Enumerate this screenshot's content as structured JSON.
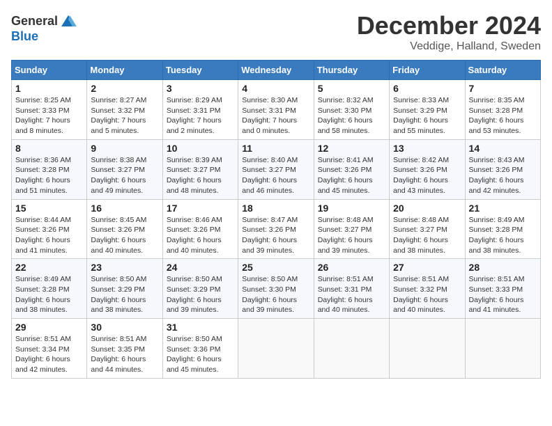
{
  "header": {
    "logo_line1": "General",
    "logo_line2": "Blue",
    "month": "December 2024",
    "location": "Veddige, Halland, Sweden"
  },
  "weekdays": [
    "Sunday",
    "Monday",
    "Tuesday",
    "Wednesday",
    "Thursday",
    "Friday",
    "Saturday"
  ],
  "weeks": [
    [
      {
        "day": "1",
        "sunrise": "Sunrise: 8:25 AM",
        "sunset": "Sunset: 3:33 PM",
        "daylight": "Daylight: 7 hours and 8 minutes."
      },
      {
        "day": "2",
        "sunrise": "Sunrise: 8:27 AM",
        "sunset": "Sunset: 3:32 PM",
        "daylight": "Daylight: 7 hours and 5 minutes."
      },
      {
        "day": "3",
        "sunrise": "Sunrise: 8:29 AM",
        "sunset": "Sunset: 3:31 PM",
        "daylight": "Daylight: 7 hours and 2 minutes."
      },
      {
        "day": "4",
        "sunrise": "Sunrise: 8:30 AM",
        "sunset": "Sunset: 3:31 PM",
        "daylight": "Daylight: 7 hours and 0 minutes."
      },
      {
        "day": "5",
        "sunrise": "Sunrise: 8:32 AM",
        "sunset": "Sunset: 3:30 PM",
        "daylight": "Daylight: 6 hours and 58 minutes."
      },
      {
        "day": "6",
        "sunrise": "Sunrise: 8:33 AM",
        "sunset": "Sunset: 3:29 PM",
        "daylight": "Daylight: 6 hours and 55 minutes."
      },
      {
        "day": "7",
        "sunrise": "Sunrise: 8:35 AM",
        "sunset": "Sunset: 3:28 PM",
        "daylight": "Daylight: 6 hours and 53 minutes."
      }
    ],
    [
      {
        "day": "8",
        "sunrise": "Sunrise: 8:36 AM",
        "sunset": "Sunset: 3:28 PM",
        "daylight": "Daylight: 6 hours and 51 minutes."
      },
      {
        "day": "9",
        "sunrise": "Sunrise: 8:38 AM",
        "sunset": "Sunset: 3:27 PM",
        "daylight": "Daylight: 6 hours and 49 minutes."
      },
      {
        "day": "10",
        "sunrise": "Sunrise: 8:39 AM",
        "sunset": "Sunset: 3:27 PM",
        "daylight": "Daylight: 6 hours and 48 minutes."
      },
      {
        "day": "11",
        "sunrise": "Sunrise: 8:40 AM",
        "sunset": "Sunset: 3:27 PM",
        "daylight": "Daylight: 6 hours and 46 minutes."
      },
      {
        "day": "12",
        "sunrise": "Sunrise: 8:41 AM",
        "sunset": "Sunset: 3:26 PM",
        "daylight": "Daylight: 6 hours and 45 minutes."
      },
      {
        "day": "13",
        "sunrise": "Sunrise: 8:42 AM",
        "sunset": "Sunset: 3:26 PM",
        "daylight": "Daylight: 6 hours and 43 minutes."
      },
      {
        "day": "14",
        "sunrise": "Sunrise: 8:43 AM",
        "sunset": "Sunset: 3:26 PM",
        "daylight": "Daylight: 6 hours and 42 minutes."
      }
    ],
    [
      {
        "day": "15",
        "sunrise": "Sunrise: 8:44 AM",
        "sunset": "Sunset: 3:26 PM",
        "daylight": "Daylight: 6 hours and 41 minutes."
      },
      {
        "day": "16",
        "sunrise": "Sunrise: 8:45 AM",
        "sunset": "Sunset: 3:26 PM",
        "daylight": "Daylight: 6 hours and 40 minutes."
      },
      {
        "day": "17",
        "sunrise": "Sunrise: 8:46 AM",
        "sunset": "Sunset: 3:26 PM",
        "daylight": "Daylight: 6 hours and 40 minutes."
      },
      {
        "day": "18",
        "sunrise": "Sunrise: 8:47 AM",
        "sunset": "Sunset: 3:26 PM",
        "daylight": "Daylight: 6 hours and 39 minutes."
      },
      {
        "day": "19",
        "sunrise": "Sunrise: 8:48 AM",
        "sunset": "Sunset: 3:27 PM",
        "daylight": "Daylight: 6 hours and 39 minutes."
      },
      {
        "day": "20",
        "sunrise": "Sunrise: 8:48 AM",
        "sunset": "Sunset: 3:27 PM",
        "daylight": "Daylight: 6 hours and 38 minutes."
      },
      {
        "day": "21",
        "sunrise": "Sunrise: 8:49 AM",
        "sunset": "Sunset: 3:28 PM",
        "daylight": "Daylight: 6 hours and 38 minutes."
      }
    ],
    [
      {
        "day": "22",
        "sunrise": "Sunrise: 8:49 AM",
        "sunset": "Sunset: 3:28 PM",
        "daylight": "Daylight: 6 hours and 38 minutes."
      },
      {
        "day": "23",
        "sunrise": "Sunrise: 8:50 AM",
        "sunset": "Sunset: 3:29 PM",
        "daylight": "Daylight: 6 hours and 38 minutes."
      },
      {
        "day": "24",
        "sunrise": "Sunrise: 8:50 AM",
        "sunset": "Sunset: 3:29 PM",
        "daylight": "Daylight: 6 hours and 39 minutes."
      },
      {
        "day": "25",
        "sunrise": "Sunrise: 8:50 AM",
        "sunset": "Sunset: 3:30 PM",
        "daylight": "Daylight: 6 hours and 39 minutes."
      },
      {
        "day": "26",
        "sunrise": "Sunrise: 8:51 AM",
        "sunset": "Sunset: 3:31 PM",
        "daylight": "Daylight: 6 hours and 40 minutes."
      },
      {
        "day": "27",
        "sunrise": "Sunrise: 8:51 AM",
        "sunset": "Sunset: 3:32 PM",
        "daylight": "Daylight: 6 hours and 40 minutes."
      },
      {
        "day": "28",
        "sunrise": "Sunrise: 8:51 AM",
        "sunset": "Sunset: 3:33 PM",
        "daylight": "Daylight: 6 hours and 41 minutes."
      }
    ],
    [
      {
        "day": "29",
        "sunrise": "Sunrise: 8:51 AM",
        "sunset": "Sunset: 3:34 PM",
        "daylight": "Daylight: 6 hours and 42 minutes."
      },
      {
        "day": "30",
        "sunrise": "Sunrise: 8:51 AM",
        "sunset": "Sunset: 3:35 PM",
        "daylight": "Daylight: 6 hours and 44 minutes."
      },
      {
        "day": "31",
        "sunrise": "Sunrise: 8:50 AM",
        "sunset": "Sunset: 3:36 PM",
        "daylight": "Daylight: 6 hours and 45 minutes."
      },
      null,
      null,
      null,
      null
    ]
  ]
}
